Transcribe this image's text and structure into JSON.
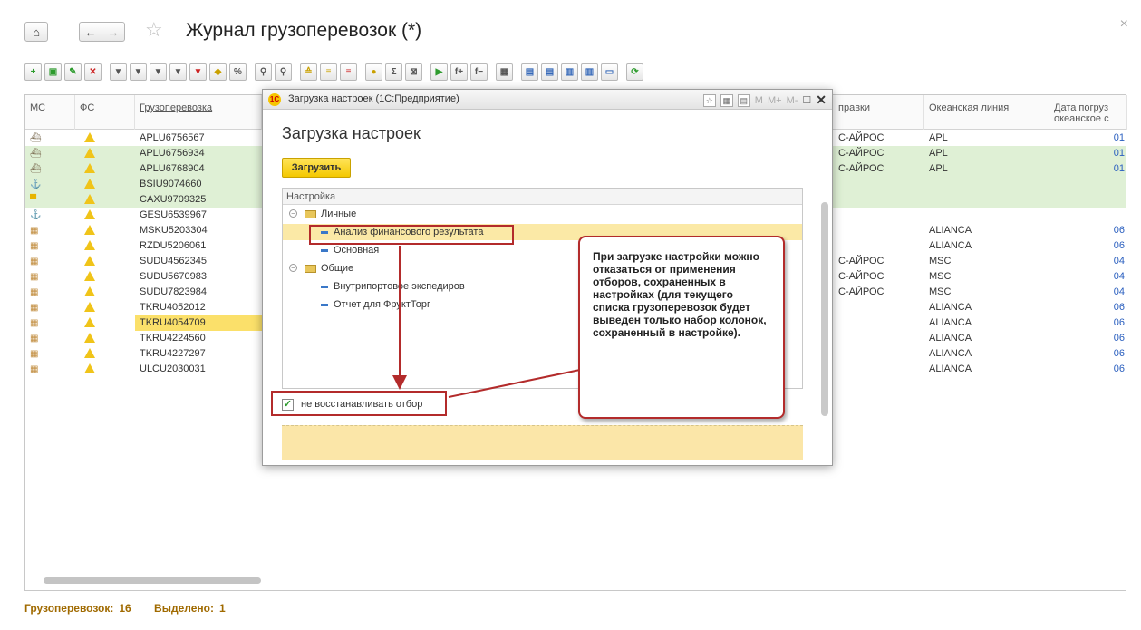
{
  "window": {
    "title": "Журнал грузоперевозок (*)",
    "home_icon": "home-icon",
    "back_icon": "arrow-left-icon",
    "forward_icon": "arrow-right-icon",
    "favorite_icon": "star-icon",
    "close_glyph": "×"
  },
  "grid": {
    "columns": {
      "ms": "МС",
      "fs": "ФС",
      "cargo": "Грузоперевозка",
      "departure": "правки",
      "line": "Океанская линия",
      "date": "Дата погруз океанское с"
    },
    "rows": [
      {
        "cargo": "APLU6756567",
        "departure": "С-АЙРОС",
        "line": "APL",
        "date": "01",
        "icon": "ship",
        "hl": "none"
      },
      {
        "cargo": "APLU6756934",
        "departure": "С-АЙРОС",
        "line": "APL",
        "date": "01",
        "icon": "ship",
        "hl": "green"
      },
      {
        "cargo": "APLU6768904",
        "departure": "С-АЙРОС",
        "line": "APL",
        "date": "01",
        "icon": "ship",
        "hl": "green"
      },
      {
        "cargo": "BSIU9074660",
        "departure": "",
        "line": "",
        "date": "",
        "icon": "anchor",
        "hl": "green"
      },
      {
        "cargo": "CAXU9709325",
        "departure": "",
        "line": "",
        "date": "",
        "icon": "box",
        "hl": "green"
      },
      {
        "cargo": "GESU6539967",
        "departure": "",
        "line": "",
        "date": "",
        "icon": "anchor",
        "hl": "none"
      },
      {
        "cargo": "MSKU5203304",
        "departure": "",
        "line": "ALIANCA",
        "date": "06",
        "icon": "crate",
        "hl": "none"
      },
      {
        "cargo": "RZDU5206061",
        "departure": "",
        "line": "ALIANCA",
        "date": "06",
        "icon": "crate",
        "hl": "none"
      },
      {
        "cargo": "SUDU4562345",
        "departure": "С-АЙРОС",
        "line": "MSC",
        "date": "04",
        "icon": "crate",
        "hl": "none"
      },
      {
        "cargo": "SUDU5670983",
        "departure": "С-АЙРОС",
        "line": "MSC",
        "date": "04",
        "icon": "crate",
        "hl": "none"
      },
      {
        "cargo": "SUDU7823984",
        "departure": "С-АЙРОС",
        "line": "MSC",
        "date": "04",
        "icon": "crate",
        "hl": "none"
      },
      {
        "cargo": "TKRU4052012",
        "departure": "",
        "line": "ALIANCA",
        "date": "06",
        "icon": "crate",
        "hl": "none"
      },
      {
        "cargo": "TKRU4054709",
        "departure": "",
        "line": "ALIANCA",
        "date": "06",
        "icon": "crate",
        "hl": "selected"
      },
      {
        "cargo": "TKRU4224560",
        "departure": "",
        "line": "ALIANCA",
        "date": "06",
        "icon": "crate",
        "hl": "none"
      },
      {
        "cargo": "TKRU4227297",
        "departure": "",
        "line": "ALIANCA",
        "date": "06",
        "icon": "crate",
        "hl": "none"
      },
      {
        "cargo": "ULCU2030031",
        "departure": "",
        "line": "ALIANCA",
        "date": "06",
        "icon": "crate",
        "hl": "none"
      }
    ]
  },
  "footer": {
    "count_label": "Грузоперевозок:",
    "count_value": "16",
    "selected_label": "Выделено:",
    "selected_value": "1"
  },
  "dialog": {
    "bar_title": "Загрузка настроек  (1С:Предприятие)",
    "bar_tools": [
      "M",
      "M+",
      "M-"
    ],
    "heading": "Загрузка настроек",
    "load_button": "Загрузить",
    "tree_header": "Настройка",
    "tree": [
      {
        "label": "Личные",
        "type": "folder",
        "level": 0
      },
      {
        "label": "Анализ финансового результата",
        "type": "item",
        "level": 1,
        "selected": true
      },
      {
        "label": "Основная",
        "type": "item",
        "level": 1
      },
      {
        "label": "Общие",
        "type": "folder",
        "level": 0
      },
      {
        "label": "Внутрипортовое экспедиров",
        "type": "item",
        "level": 1
      },
      {
        "label": "Отчет для ФруктТорг",
        "type": "item",
        "level": 1
      }
    ],
    "checkbox_label": "не восстанавливать отбор",
    "checkbox_checked": true
  },
  "callout": {
    "text": "При загрузке настройки можно отказаться от применения отборов, сохраненных в настройках (для текущего списка грузоперевозок будет выведен только набор колонок, сохраненный в настройке)."
  },
  "colors": {
    "highlight_green": "#dff0d5",
    "selected_yellow": "#fbe06a",
    "annotation_red": "#b32b2b",
    "footer_text": "#a06a00"
  }
}
